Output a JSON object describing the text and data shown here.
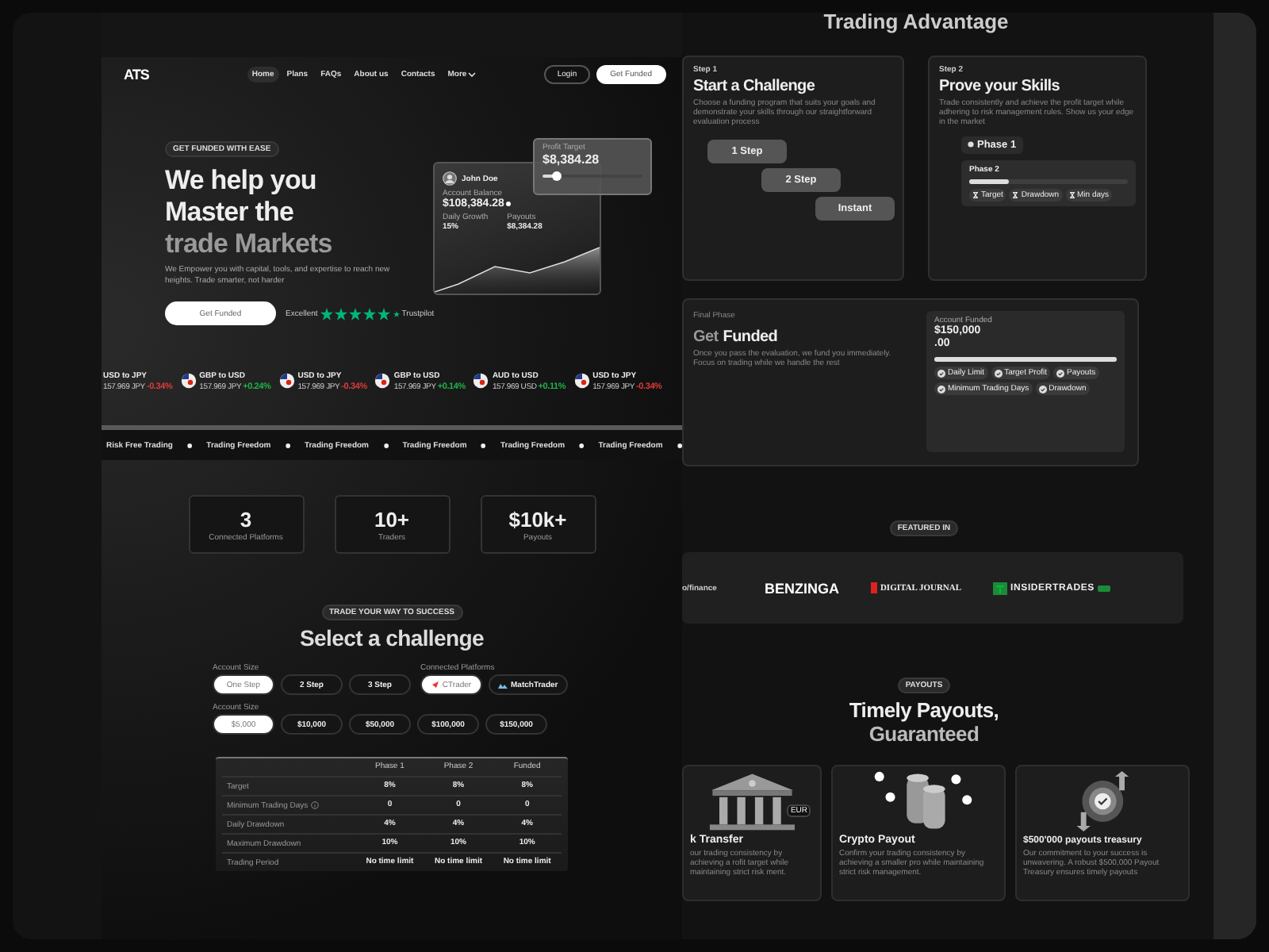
{
  "nav": {
    "logo": "ATS",
    "links": [
      {
        "label": "Home",
        "selected": true
      },
      {
        "label": "Plans",
        "selected": false
      },
      {
        "label": "FAQs",
        "selected": false
      },
      {
        "label": "About us",
        "selected": false
      },
      {
        "label": "Contacts",
        "selected": false
      },
      {
        "label": "More",
        "selected": false,
        "kind": "menu"
      }
    ],
    "login": "Login",
    "cta": "Get Funded"
  },
  "hero": {
    "badge": "GET FUNDED WITH EASE",
    "headline": [
      {
        "text": "We help you",
        "muted": false
      },
      {
        "text": "Master the",
        "muted": false
      },
      {
        "text": "trade Markets",
        "muted": true
      }
    ],
    "subtitle": "We Empower you with capital, tools, and expertise to reach new heights. Trade smarter, not harder",
    "button": "Get Funded",
    "rating": {
      "label": "Excellent",
      "stars": 5,
      "brand": "Trustpilot"
    },
    "account": {
      "name": "John Doe",
      "balance_label": "Account Balance",
      "balance": "$108,384.28",
      "stats": [
        {
          "label": "Daily Growth",
          "value": "15%"
        },
        {
          "label": "Payouts",
          "value": "$8,384.28"
        }
      ]
    },
    "profit": {
      "label": "Profit Target",
      "value": "$8,384.28",
      "level": 0.15
    }
  },
  "tickers": [
    {
      "pair": "USD to JPY",
      "price": "157.969 JPY",
      "change": "-0.34%",
      "color": "#e03a3a",
      "flag": false
    },
    {
      "pair": "GBP to USD",
      "price": "157.969 JPY",
      "change": "+0.24%",
      "color": "#1fb34a",
      "flag": true
    },
    {
      "pair": "USD to JPY",
      "price": "157.969 JPY",
      "change": "-0.34%",
      "color": "#e03a3a",
      "flag": true
    },
    {
      "pair": "GBP to USD",
      "price": "157.969 JPY",
      "change": "+0.14%",
      "color": "#1fb34a",
      "flag": true
    },
    {
      "pair": "AUD to USD",
      "price": "157.969 USD",
      "change": "+0.11%",
      "color": "#1fb34a",
      "flag": true
    },
    {
      "pair": "USD to JPY",
      "price": "157.969 JPY",
      "change": "-0.34%",
      "color": "#e03a3a",
      "flag": true
    }
  ],
  "marquee": [
    "Risk Free Trading",
    "Trading Freedom",
    "Trading Freedom",
    "Trading Freedom",
    "Trading Freedom",
    "Trading Freedom"
  ],
  "stats": [
    {
      "value": "3",
      "label": "Connected Platforms"
    },
    {
      "value": "10+",
      "label": "Traders"
    },
    {
      "value": "$10k+",
      "label": "Payouts"
    }
  ],
  "challenge": {
    "badge": "TRADE YOUR WAY TO SUCCESS",
    "title": "Select a challenge",
    "steps_label": "Account Size",
    "steps": [
      {
        "label": "One Step",
        "selected": true
      },
      {
        "label": "2 Step",
        "selected": false
      },
      {
        "label": "3 Step",
        "selected": false
      }
    ],
    "platforms_label": "Connected Platforms",
    "platforms": [
      {
        "label": "CTrader",
        "selected": true
      },
      {
        "label": "MatchTrader",
        "selected": false
      }
    ],
    "sizes_label": "Account Size",
    "sizes": [
      {
        "label": "$5,000",
        "selected": true
      },
      {
        "label": "$10,000",
        "selected": false
      },
      {
        "label": "$50,000",
        "selected": false
      },
      {
        "label": "$100,000",
        "selected": false
      },
      {
        "label": "$150,000",
        "selected": false
      }
    ],
    "table": {
      "columns": [
        "Phase 1",
        "Phase 2",
        "Funded"
      ],
      "rows": [
        {
          "label": "Target",
          "values": [
            "8%",
            "8%",
            "8%"
          ],
          "info": false
        },
        {
          "label": "Minimum Trading Days",
          "values": [
            "0",
            "0",
            "0"
          ],
          "info": true
        },
        {
          "label": "Daily Drawdown",
          "values": [
            "4%",
            "4%",
            "4%"
          ],
          "info": false
        },
        {
          "label": "Maximum Drawdown",
          "values": [
            "10%",
            "10%",
            "10%"
          ],
          "info": false
        },
        {
          "label": "Trading Period",
          "values": [
            "No time limit",
            "No time limit",
            "No time limit"
          ],
          "info": false
        }
      ]
    }
  },
  "advantage": {
    "title": "Trading Advantage",
    "step1": {
      "step": "Step 1",
      "title": "Start a Challenge",
      "text": "Choose a funding program that suits your goals and demonstrate your skills through our straightforward evaluation process",
      "options": [
        "1 Step",
        "2 Step",
        "Instant"
      ]
    },
    "step2": {
      "step": "Step 2",
      "title": "Prove your Skills",
      "text": "Trade consistently and achieve the profit target while adhering to risk management rules. Show us your edge in the market",
      "phase1": "Phase 1",
      "phase2": "Phase 2",
      "level": 0.25,
      "chips": [
        "Target",
        "Drawdown",
        "Min days"
      ]
    },
    "final": {
      "step": "Final Phase",
      "title_muted": "Get",
      "title": "Funded",
      "text": "Once you pass the evaluation, we fund you immediately. Focus on trading while we handle the rest",
      "panel_label": "Account Funded",
      "amount": "$150,000",
      "cents": ".00",
      "level": 1,
      "chips": [
        "Daily Limit",
        "Target Profit",
        "Payouts",
        "Minimum Trading Days",
        "Drawdown"
      ]
    }
  },
  "featured": {
    "badge": "FEATURED IN",
    "logos": [
      {
        "text": "o/finance",
        "kind": "plain"
      },
      {
        "text": "BENZINGA",
        "kind": "bold"
      },
      {
        "text": "DIGITAL JOURNAL",
        "kind": "serif"
      },
      {
        "text": "INSIDERTRADES",
        "kind": "insider"
      }
    ]
  },
  "payouts": {
    "badge": "PAYOUTS",
    "title": [
      "Timely Payouts,",
      "Guaranteed"
    ],
    "cards": [
      {
        "kind": "bank",
        "title": "k Transfer",
        "tag": "EUR",
        "text": "our trading consistency by achieving a rofit target while maintaining strict risk ment."
      },
      {
        "kind": "crypto",
        "title": "Crypto Payout",
        "text": "Confirm your trading consistency by achieving a smaller pro while maintaining strict risk management."
      },
      {
        "kind": "treasury",
        "title": "$500'000 payouts treasury",
        "text": "Our commitment to your success is unwavering. A robust $500,000 Payout Treasury ensures timely payouts"
      }
    ]
  }
}
